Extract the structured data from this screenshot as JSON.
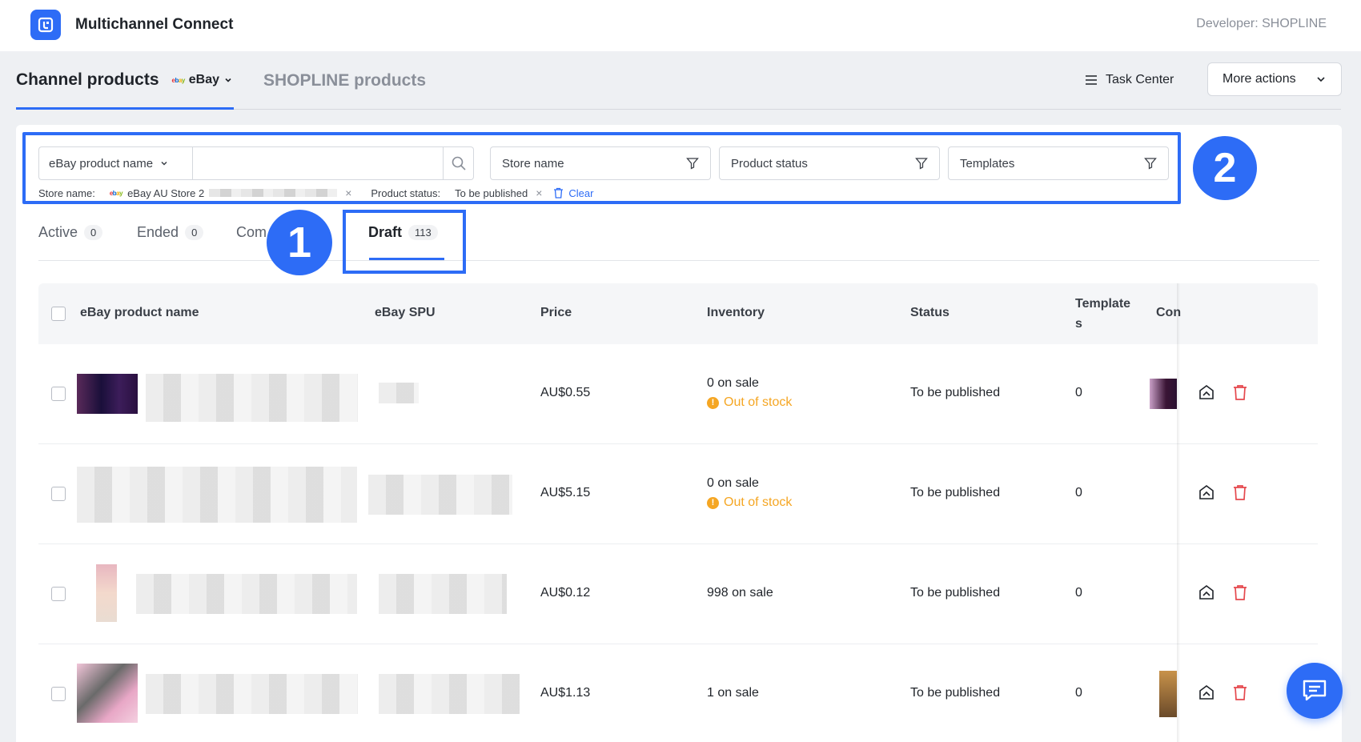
{
  "app": {
    "name": "Multichannel Connect",
    "developer": "Developer: SHOPLINE"
  },
  "header_tabs": {
    "channel_products": "Channel products",
    "channel_selector": "eBay",
    "shopline_products": "SHOPLINE products",
    "task_center": "Task Center",
    "more_actions": "More actions"
  },
  "filters": {
    "search_field_selector": "eBay product name",
    "search_value": "",
    "store_name_placeholder": "Store name",
    "product_status_placeholder": "Product status",
    "templates_placeholder": "Templates"
  },
  "applied_filters": {
    "store_label": "Store name:",
    "store_value": "eBay AU Store 2",
    "status_label": "Product status:",
    "status_value": "To be published",
    "clear": "Clear"
  },
  "annotations": {
    "badge_1": "1",
    "badge_2": "2"
  },
  "status_tabs": [
    {
      "label": "Active",
      "count": "0"
    },
    {
      "label": "Ended",
      "count": "0"
    },
    {
      "label": "Com",
      "count": ""
    },
    {
      "label": "Draft",
      "count": "113"
    }
  ],
  "table": {
    "headers": {
      "name": "eBay product name",
      "spu": "eBay SPU",
      "price": "Price",
      "inventory": "Inventory",
      "status": "Status",
      "templates_1": "Template",
      "templates_2": "s",
      "con": "Con"
    },
    "rows": [
      {
        "price": "AU$0.55",
        "inventory": "0 on sale",
        "stock_warning": "Out of stock",
        "status": "To be published",
        "templates": "0"
      },
      {
        "price": "AU$5.15",
        "inventory": "0 on sale",
        "stock_warning": "Out of stock",
        "status": "To be published",
        "templates": "0"
      },
      {
        "price": "AU$0.12",
        "inventory": "998 on sale",
        "stock_warning": "",
        "status": "To be published",
        "templates": "0"
      },
      {
        "price": "AU$1.13",
        "inventory": "1 on sale",
        "stock_warning": "",
        "status": "To be published",
        "templates": "0"
      }
    ]
  },
  "colors": {
    "accent": "#2d6cf6",
    "warning": "#f5a623",
    "danger": "#e5484d"
  }
}
